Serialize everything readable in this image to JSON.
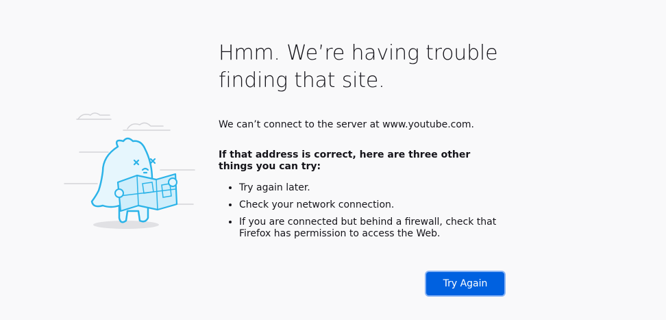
{
  "error": {
    "title": "Hmm. We’re having trouble finding that site.",
    "description": "We can’t connect to the server at www.youtube.com.",
    "subheading": "If that address is correct, here are three other things you can try:",
    "tips": [
      "Try again later.",
      "Check your network connection.",
      "If you are connected but behind a firewall, check that Firefox has permission to access the Web."
    ]
  },
  "actions": {
    "try_again_label": "Try Again"
  },
  "colors": {
    "background": "#f9f9fa",
    "primary_button": "#0061e0",
    "illustration_stroke": "#2bb3e8",
    "illustration_fill": "#cfeefb"
  },
  "icons": {
    "illustration": "confused-monster-with-map-illustration"
  }
}
